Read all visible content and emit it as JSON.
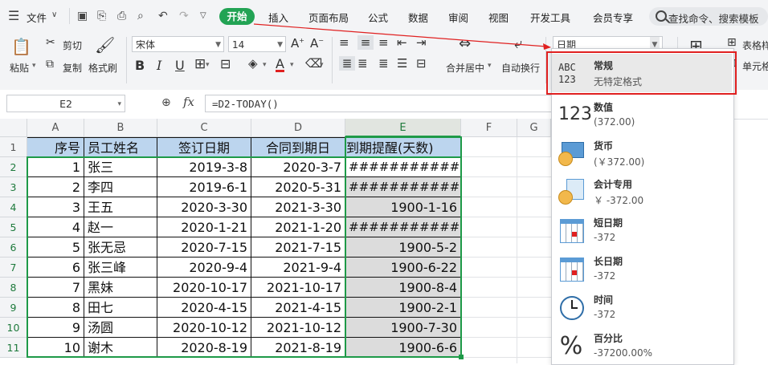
{
  "menubar": {
    "file": "文件",
    "tabs": [
      "开始",
      "插入",
      "页面布局",
      "公式",
      "数据",
      "审阅",
      "视图",
      "开发工具",
      "会员专享"
    ],
    "search_placeholder": "查找命令、搜索模板"
  },
  "ribbon": {
    "paste": "粘贴",
    "cut": "剪切",
    "copy": "复制",
    "format_painter": "格式刷",
    "font_name": "宋体",
    "font_size": "14",
    "merge_center": "合并居中",
    "wrap_text": "自动换行",
    "number_format": "日期",
    "table_style": "表格样",
    "cell": "单元格"
  },
  "formula": {
    "name_box": "E2",
    "fx": "fx",
    "content": "=D2-TODAY()"
  },
  "sheet": {
    "columns": [
      "A",
      "B",
      "C",
      "D",
      "E",
      "F",
      "G"
    ],
    "headers": [
      "序号",
      "员工姓名",
      "签订日期",
      "合同到期日",
      "到期提醒(天数)"
    ],
    "rows": [
      [
        "1",
        "张三",
        "2019-3-8",
        "2020-3-7",
        "#############"
      ],
      [
        "2",
        "李四",
        "2019-6-1",
        "2020-5-31",
        "#############"
      ],
      [
        "3",
        "王五",
        "2020-3-30",
        "2021-3-30",
        "1900-1-16"
      ],
      [
        "4",
        "赵一",
        "2020-1-21",
        "2021-1-20",
        "#############"
      ],
      [
        "5",
        "张无忌",
        "2020-7-15",
        "2021-7-15",
        "1900-5-2"
      ],
      [
        "6",
        "张三峰",
        "2020-9-4",
        "2021-9-4",
        "1900-6-22"
      ],
      [
        "7",
        "黑妹",
        "2020-10-17",
        "2021-10-17",
        "1900-8-4"
      ],
      [
        "8",
        "田七",
        "2020-4-15",
        "2021-4-15",
        "1900-2-1"
      ],
      [
        "9",
        "汤圆",
        "2020-10-12",
        "2021-10-12",
        "1900-7-30"
      ],
      [
        "10",
        "谢木",
        "2020-8-19",
        "2021-8-19",
        "1900-6-6"
      ]
    ],
    "row_numbers": [
      "1",
      "2",
      "3",
      "4",
      "5",
      "6",
      "7",
      "8",
      "9",
      "10",
      "11"
    ]
  },
  "number_formats": [
    {
      "name": "常规",
      "example": "无特定格式",
      "icon": "abc-123-icon"
    },
    {
      "name": "数值",
      "example": "(372.00)",
      "icon": "number-123-icon"
    },
    {
      "name": "货币",
      "example": "(￥372.00)",
      "icon": "currency-icon"
    },
    {
      "name": "会计专用",
      "example": "￥ -372.00",
      "icon": "accounting-icon"
    },
    {
      "name": "短日期",
      "example": "-372",
      "icon": "calendar-icon"
    },
    {
      "name": "长日期",
      "example": "-372",
      "icon": "calendar-icon"
    },
    {
      "name": "时间",
      "example": "-372",
      "icon": "clock-icon"
    },
    {
      "name": "百分比",
      "example": "-37200.00%",
      "icon": "percent-icon"
    }
  ],
  "colors": {
    "accent": "#22a354",
    "header_fill": "#bcd5ee",
    "selection_border": "#1e9a48",
    "highlight_red": "#e02020"
  }
}
